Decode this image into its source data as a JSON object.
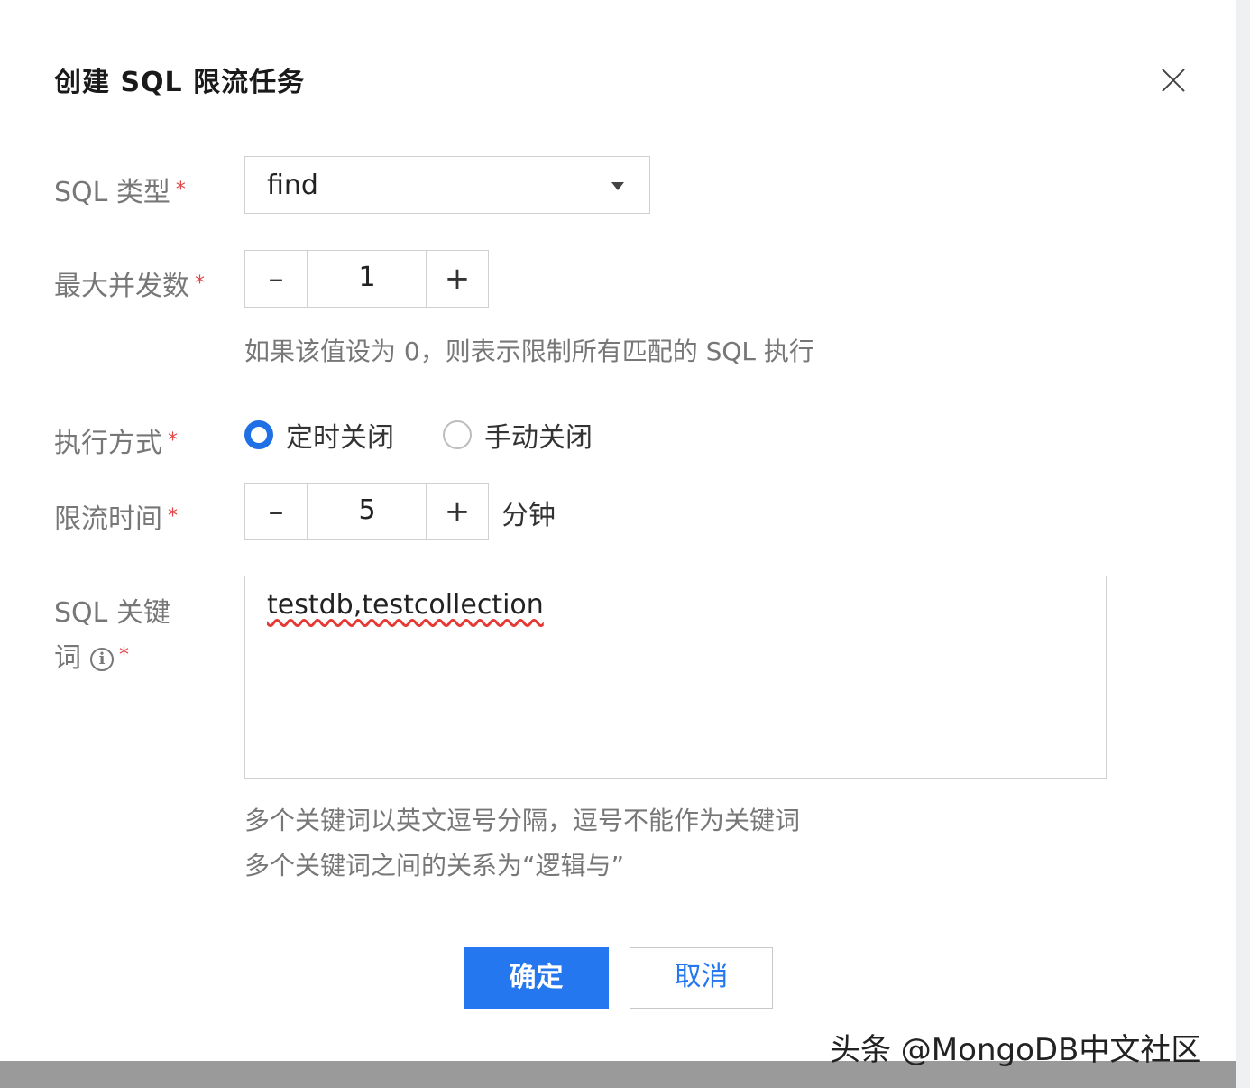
{
  "dialog": {
    "title": "创建 SQL 限流任务"
  },
  "fields": {
    "sql_type": {
      "label": "SQL 类型",
      "value": "find"
    },
    "max_concurrency": {
      "label": "最大并发数",
      "value": "1",
      "hint": "如果该值设为 0，则表示限制所有匹配的 SQL 执行",
      "minus": "–",
      "plus": "+"
    },
    "exec_mode": {
      "label": "执行方式",
      "options": [
        "定时关闭",
        "手动关闭"
      ],
      "selected": "定时关闭"
    },
    "limit_time": {
      "label": "限流时间",
      "value": "5",
      "unit": "分钟",
      "minus": "–",
      "plus": "+"
    },
    "sql_keywords": {
      "label_line1": "SQL 关键",
      "label_line2": "词",
      "info": "i",
      "value": "testdb,testcollection",
      "hint_line1": "多个关键词以英文逗号分隔，逗号不能作为关键词",
      "hint_line2": "多个关键词之间的关系为“逻辑与”"
    },
    "required_mark": "*"
  },
  "buttons": {
    "confirm": "确定",
    "cancel": "取消"
  },
  "watermark": "头条 @MongoDB中文社区",
  "colors": {
    "primary": "#2477ee",
    "required": "#e54545"
  }
}
